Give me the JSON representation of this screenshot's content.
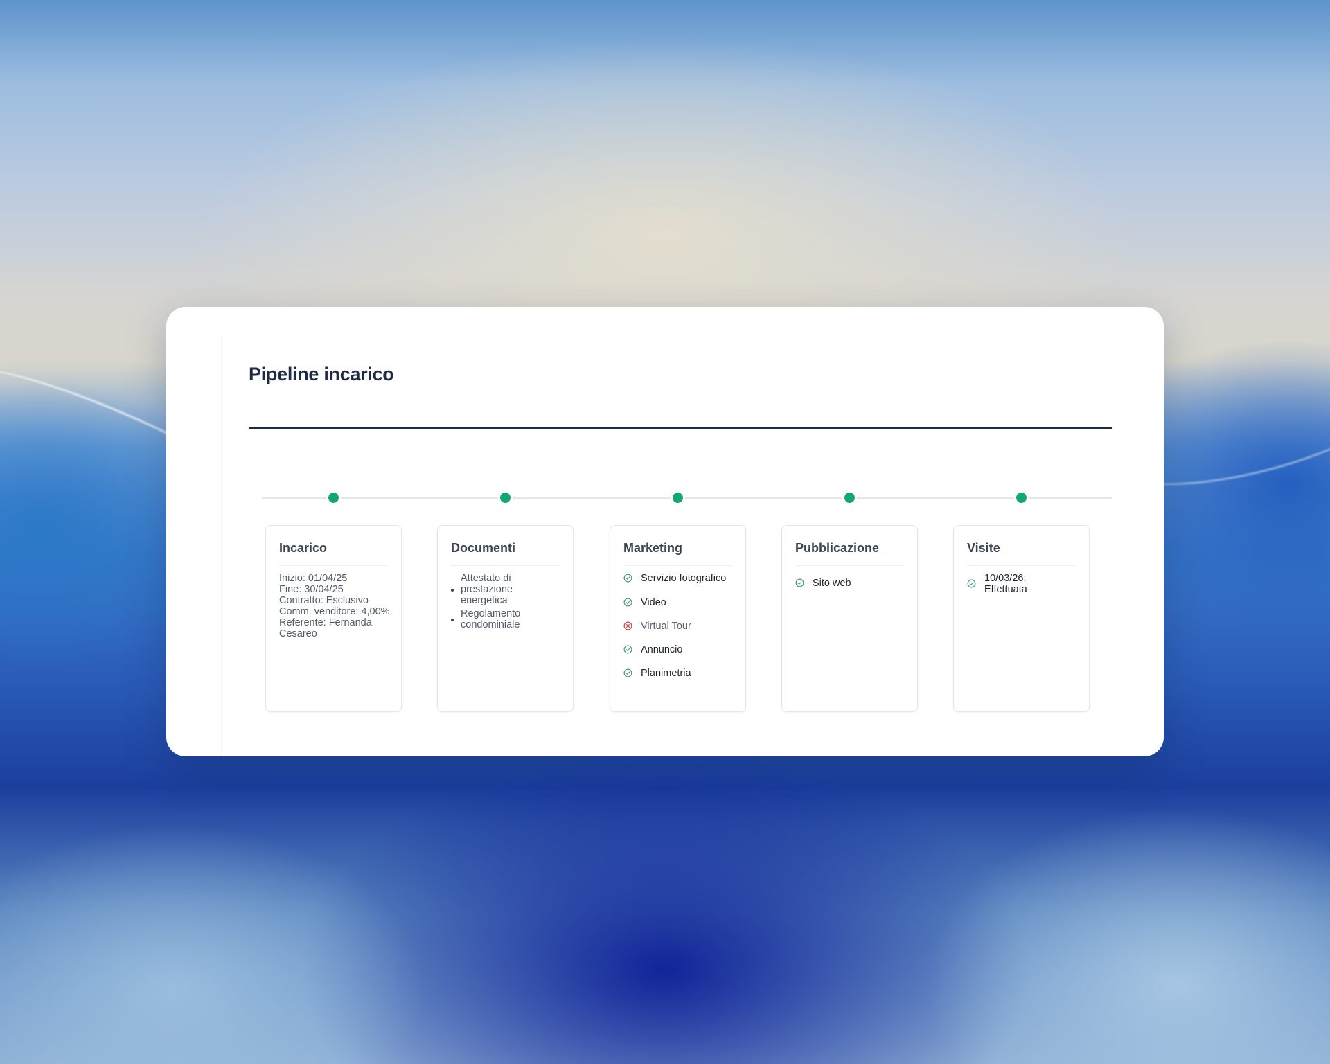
{
  "pipeline": {
    "title": "Pipeline incarico"
  },
  "stages": {
    "incarico": {
      "title": "Incarico",
      "lines": [
        "Inizio: 01/04/25",
        "Fine: 30/04/25",
        "Contratto: Esclusivo",
        "Comm. venditore: 4,00%",
        "Referente: Fernanda Cesareo"
      ]
    },
    "documenti": {
      "title": "Documenti",
      "items": [
        "Attestato di prestazione energetica",
        "Regolamento condominiale"
      ]
    },
    "marketing": {
      "title": "Marketing",
      "items": [
        {
          "label": "Servizio fotografico",
          "status": "done"
        },
        {
          "label": "Video",
          "status": "done"
        },
        {
          "label": "Virtual Tour",
          "status": "missing"
        },
        {
          "label": "Annuncio",
          "status": "done"
        },
        {
          "label": "Planimetria",
          "status": "done"
        }
      ]
    },
    "pubblicazione": {
      "title": "Pubblicazione",
      "items": [
        {
          "label": "Sito web",
          "status": "done"
        }
      ]
    },
    "visite": {
      "title": "Visite",
      "items": [
        {
          "label": "10/03/26: Effettuata",
          "status": "done"
        }
      ]
    }
  },
  "colors": {
    "title": "#1f2b44",
    "dot_complete": "#12a671",
    "check_icon": "#4a9a8e",
    "cross_icon": "#d9434a"
  },
  "icons": {
    "done": "check-circle-icon",
    "missing": "x-circle-icon"
  }
}
